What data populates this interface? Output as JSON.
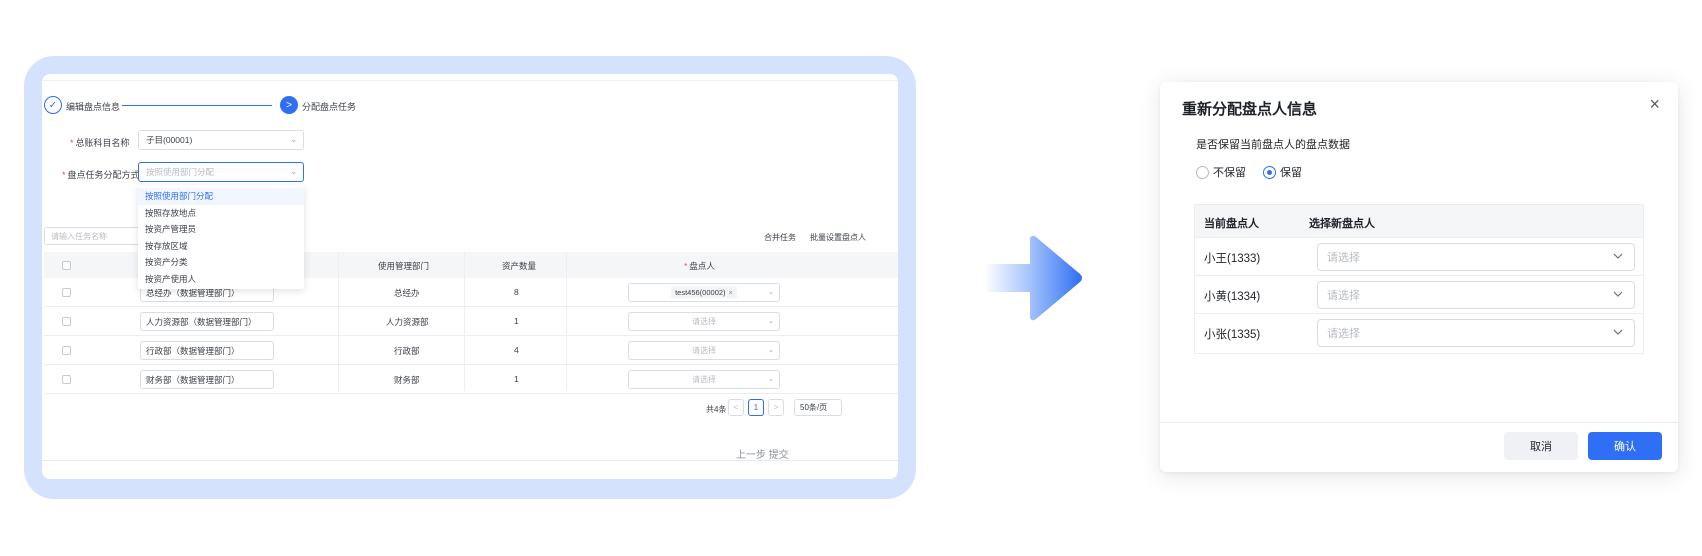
{
  "left_screen": {
    "steps": [
      {
        "label": "编辑盘点信息"
      },
      {
        "label": "分配盘点任务"
      }
    ],
    "step1_icon": "✓",
    "step2_icon": ">",
    "form": {
      "book_label": "总账科目名称",
      "book_value": "子目(00001)",
      "method_label": "盘点任务分配方式",
      "method_placeholder": "按照使用部门分配",
      "options": [
        "按照使用部门分配",
        "按照存放地点",
        "按资产管理员",
        "按存放区域",
        "按资产分类",
        "按资产使用人"
      ]
    },
    "search_placeholder": "请输入任务名称",
    "toolbar": {
      "merge": "合并任务",
      "batch": "批量设置盘点人"
    },
    "table": {
      "headers": [
        "",
        "使用管理部门",
        "资产数量",
        "盘点人"
      ],
      "rows": [
        {
          "name": "总经办（数据管理部门）",
          "dept": "总经办",
          "count": "8",
          "assignee": "test456(00002)"
        },
        {
          "name": "人力资源部（数据管理部门）",
          "dept": "人力资源部",
          "count": "1",
          "assignee": "请选择"
        },
        {
          "name": "行政部（数据管理部门）",
          "dept": "行政部",
          "count": "4",
          "assignee": "请选择"
        },
        {
          "name": "财务部（数据管理部门）",
          "dept": "财务部",
          "count": "1",
          "assignee": "请选择"
        }
      ]
    },
    "pagination": {
      "total": "共4条",
      "prev": "<",
      "page": "1",
      "next": ">",
      "size": "50条/页"
    },
    "bottom_buttons": "上一步  提交"
  },
  "dialog": {
    "title": "重新分配盘点人信息",
    "close_icon": "×",
    "question": "是否保留当前盘点人的盘点数据",
    "radio_options": [
      {
        "label": "不保留",
        "checked": false
      },
      {
        "label": "保留",
        "checked": true
      }
    ],
    "table": {
      "col_current": "当前盘点人",
      "col_new": "选择新盘点人",
      "rows": [
        {
          "current": "小王(1333)",
          "placeholder": "请选择"
        },
        {
          "current": "小黄(1334)",
          "placeholder": "请选择"
        },
        {
          "current": "小张(1335)",
          "placeholder": "请选择"
        }
      ]
    },
    "cancel_label": "取消",
    "confirm_label": "确认"
  },
  "colors": {
    "frame": "#d4e2fd",
    "primary": "#2f6ff5",
    "required": "#e34d59"
  },
  "icons": [
    "check-icon",
    "chevron-right-icon",
    "chevron-down-icon",
    "close-icon",
    "arrow-right-icon",
    "tag-close-icon"
  ]
}
